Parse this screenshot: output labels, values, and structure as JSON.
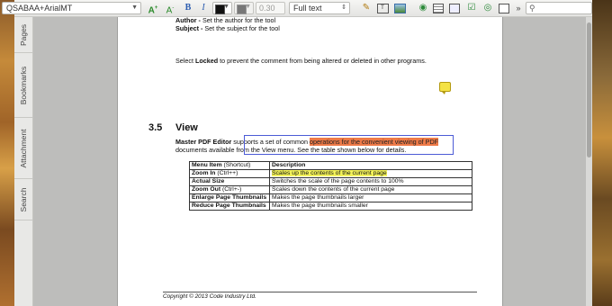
{
  "toolbar": {
    "font_name": "QSABAA+ArialMT",
    "line_width": "0.30",
    "text_style": "Full text",
    "search_placeholder": ""
  },
  "side_tabs": [
    "Pages",
    "Bookmarks",
    "Attachment",
    "Search"
  ],
  "document": {
    "author_label": "Author -",
    "author_text": " Set the author for the tool",
    "subject_label": "Subject -",
    "subject_text": " Set the subject for the tool",
    "locked_pre": "Select ",
    "locked_bold": "Locked",
    "locked_post": " to prevent the comment from being altered or deleted in other programs.",
    "section_number": "3.5",
    "section_title": "View",
    "para_bold": "Master PDF Editor",
    "para_1": " supports a set of common ",
    "para_highlight": "operations for the convenient viewing of PDF",
    "para_2": "documents available from the View menu. See the table shown below for details.",
    "table": {
      "header_item": "Menu Item",
      "header_shortcut": " (Shortcut)",
      "header_desc": "Description",
      "rows": [
        {
          "item": "Zoom In",
          "shortcut": " (Ctrl++)",
          "desc": "Scales up the contents of the current page",
          "highlight": true
        },
        {
          "item": "Actual Size",
          "shortcut": "",
          "desc": "Switches the scale of the page contents to 100%",
          "highlight": false
        },
        {
          "item": "Zoom Out",
          "shortcut": " (Ctrl+-)",
          "desc": "Scales down the contents of the current page",
          "highlight": false
        },
        {
          "item": "Enlarge Page Thumbnails",
          "shortcut": "",
          "desc": "Makes the page thumbnails larger",
          "highlight": false
        },
        {
          "item": "Reduce Page Thumbnails",
          "shortcut": "",
          "desc": "Makes the page thumbnails smaller",
          "highlight": false
        }
      ]
    },
    "footer": "Copyright © 2013 Code Industry Ltd."
  },
  "colors": {
    "highlight_red": "#ee7a48",
    "highlight_yellow": "#f4f35a",
    "annotation_border": "#4c5bd6"
  }
}
